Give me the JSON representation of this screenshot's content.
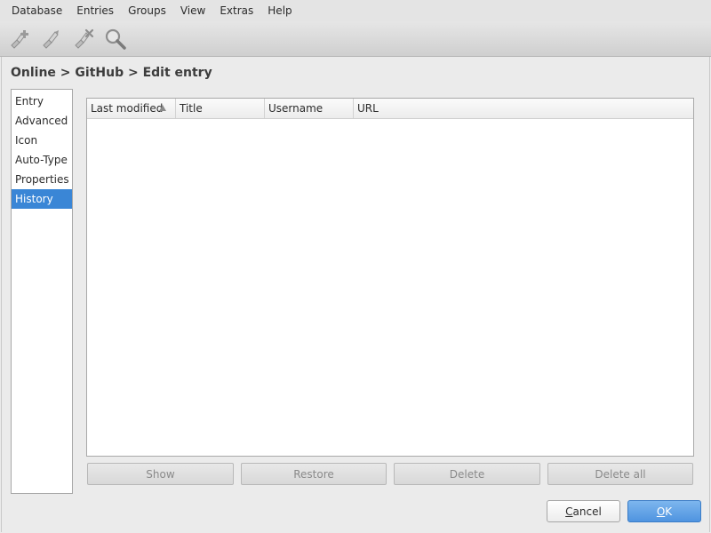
{
  "menubar": {
    "items": [
      {
        "label": "Database"
      },
      {
        "label": "Entries"
      },
      {
        "label": "Groups"
      },
      {
        "label": "View"
      },
      {
        "label": "Extras"
      },
      {
        "label": "Help"
      }
    ]
  },
  "toolbar": {
    "buttons": [
      {
        "icon": "add-entry-icon"
      },
      {
        "icon": "edit-entry-icon"
      },
      {
        "icon": "delete-entry-icon"
      },
      {
        "icon": "search-icon"
      }
    ]
  },
  "breadcrumb": "Online > GitHub > Edit entry",
  "categories": {
    "items": [
      {
        "label": "Entry"
      },
      {
        "label": "Advanced"
      },
      {
        "label": "Icon"
      },
      {
        "label": "Auto-Type"
      },
      {
        "label": "Properties"
      },
      {
        "label": "History"
      }
    ],
    "selected": "History"
  },
  "history_table": {
    "columns": [
      "Last modified",
      "Title",
      "Username",
      "URL"
    ],
    "sort_column": "Last modified",
    "sort_order": "ascending",
    "rows": []
  },
  "history_buttons": {
    "show": "Show",
    "restore": "Restore",
    "delete": "Delete",
    "delete_all": "Delete all"
  },
  "dialog_buttons": {
    "cancel_mnemonic": "C",
    "cancel_rest": "ancel",
    "ok_mnemonic": "O",
    "ok_rest": "K"
  },
  "colors": {
    "selection": "#3a86d6",
    "ok_button": "#5a9be3"
  }
}
